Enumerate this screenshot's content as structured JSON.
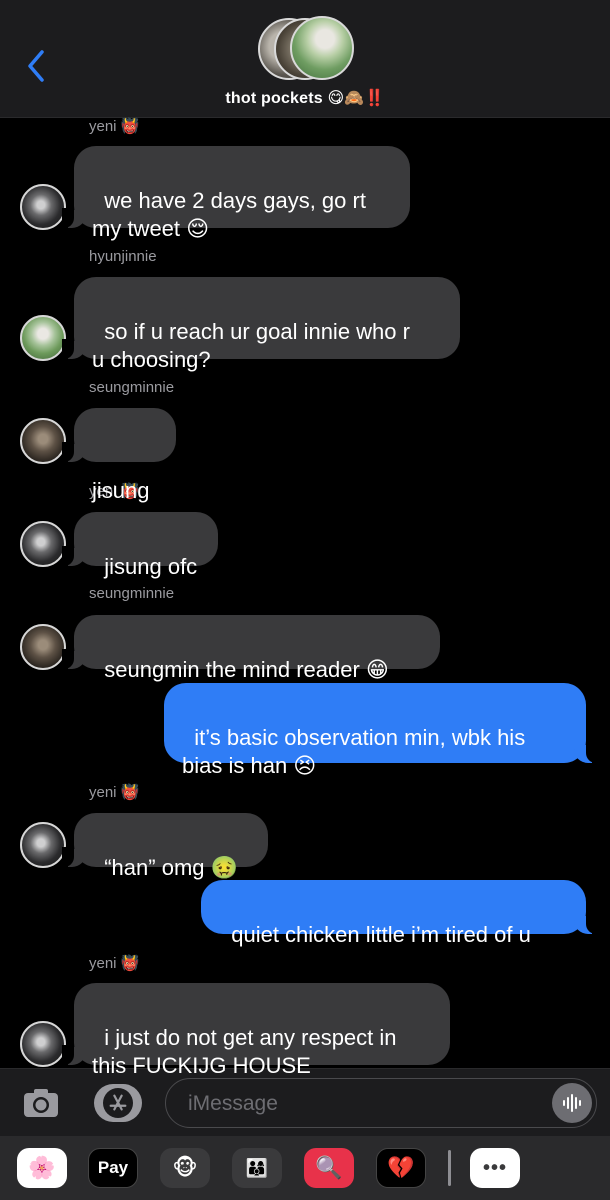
{
  "header": {
    "title": "thot pockets 😋🙈‼️"
  },
  "messages": [
    {
      "sender": "yeni 👹",
      "text": "we have 2 days gays, go rt\nmy tweet 😌"
    },
    {
      "sender": "hyunjinnie",
      "text": "so if u reach ur goal innie who r\nu choosing?"
    },
    {
      "sender": "seungminnie",
      "text": "jisung"
    },
    {
      "sender": "yeni 👹",
      "text": "jisung ofc"
    },
    {
      "sender": "seungminnie",
      "text": "seungmin the mind reader 😁"
    },
    {
      "sender": "",
      "text": "it’s basic observation min, wbk his\nbias is han 😣"
    },
    {
      "sender": "yeni 👹",
      "text": "“han” omg 🤢"
    },
    {
      "sender": "",
      "text": "quiet chicken little i’m tired of u"
    },
    {
      "sender": "yeni 👹",
      "text": "i just do not get any respect in\nthis FUCKIJG HOUSE"
    }
  ],
  "input": {
    "placeholder": "iMessage"
  },
  "apps": {
    "photos": "🌸",
    "applepay": "Pay",
    "memoji1": "🐵",
    "memoji2": "👨‍👩‍👦",
    "search": "🔍",
    "digitaltouch": "💔",
    "more": "•••"
  },
  "colors": {
    "outgoing_bubble": "#2f7df6",
    "incoming_bubble": "#3a3a3c",
    "header_bg": "#1c1c1e",
    "accent": "#2f7df6"
  }
}
